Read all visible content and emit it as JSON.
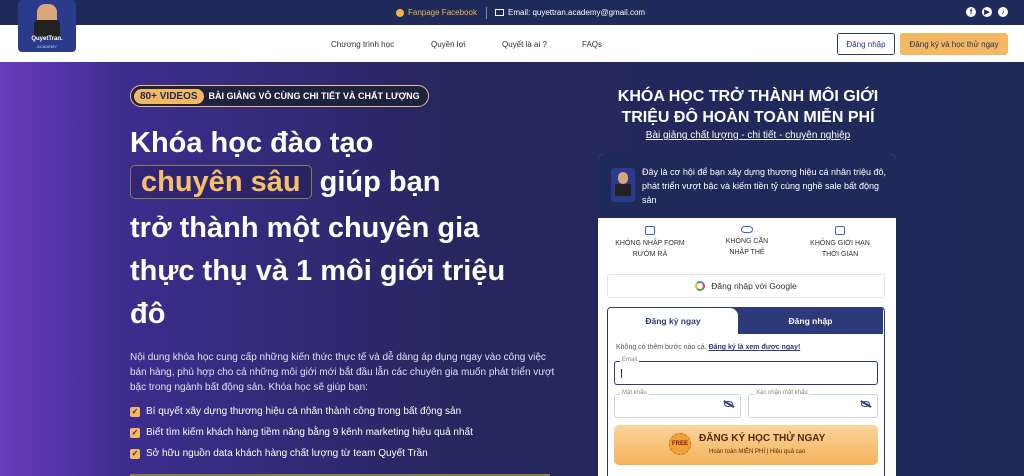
{
  "topbar": {
    "facebook_label": "Fanpage Facebook",
    "email_label": "Email: quyettran.academy@gmail.com",
    "socials": [
      "facebook-icon",
      "youtube-icon",
      "tiktok-icon"
    ]
  },
  "logo": {
    "name": "QuyetTran.",
    "sub": "ACADEMY"
  },
  "nav": {
    "items": [
      "Chương trình học",
      "Quyền lợi",
      "Quyết là ai ?",
      "FAQs"
    ],
    "login_label": "Đăng nhập",
    "signup_label": "Đăng ký và học thử ngay"
  },
  "hero": {
    "badge": "80+ VIDEOS",
    "badge_text": "BÀI GIẢNG VÔ CÙNG CHI TIẾT VÀ CHẤT LƯỢNG",
    "line1": "Khóa học đào tạo",
    "highlight": "chuyên sâu",
    "line2_rest": "giúp bạn",
    "line3": "trở thành một chuyên gia",
    "line4": "thực thụ và 1 môi giới triệu",
    "line5": "đô",
    "description": "Nội dung khóa học cung cấp những kiến thức thực tế và dễ dàng áp dụng ngay vào công việc bán hàng, phù hợp cho cả những môi giới mới bắt đầu lẫn các chuyên gia muốn phát triển vượt bậc trong ngành bất động sản. Khóa học sẽ giúp bạn:",
    "bullets": [
      "Bí quyết xây dựng thương hiệu cá nhân thành công trong bất động sản",
      "Biết tìm kiếm khách hàng tiềm năng bằng 9 kênh marketing hiệu quả nhất",
      "Sở hữu nguồn data khách hàng chất lượng từ team Quyết Trần"
    ]
  },
  "signup": {
    "title_line1": "KHÓA HỌC TRỞ THÀNH MÔI GIỚI",
    "title_line2": "TRIỆU ĐÔ HOÀN TOÀN MIỄN PHÍ",
    "subtitle": "Bài giảng chất lượng - chi tiết - chuyên nghiệp",
    "intro": "Đây là cơ hội để bạn xây dựng thương hiệu cá nhân triệu đô, phát triển vượt bậc và kiếm tiền tỷ cùng nghề sale bất động sản",
    "features": [
      {
        "l1": "KHÔNG NHẬP FORM",
        "l2": "RƯỜM RÀ"
      },
      {
        "l1": "KHÔNG CẦN",
        "l2": "NHẬP THẺ"
      },
      {
        "l1": "KHÔNG GIỚI HẠN",
        "l2": "THỜI GIAN"
      }
    ],
    "google_label": "Đăng nhập với Google",
    "tab_register": "Đăng ký ngay",
    "tab_login": "Đăng nhập",
    "note": "Không có thêm bước nào cả.",
    "note_link": "Đăng ký là xem được ngay!",
    "email_label": "Email",
    "email_value": "",
    "password_label": "Mật khẩu",
    "confirm_label": "Xác nhận mật khẩu",
    "free_badge": "FREE",
    "cta_title": "ĐĂNG KÝ HỌC THỬ NGAY",
    "cta_sub": "Hoàn toàn MIỄN PHÍ | Hiệu quả cao"
  }
}
